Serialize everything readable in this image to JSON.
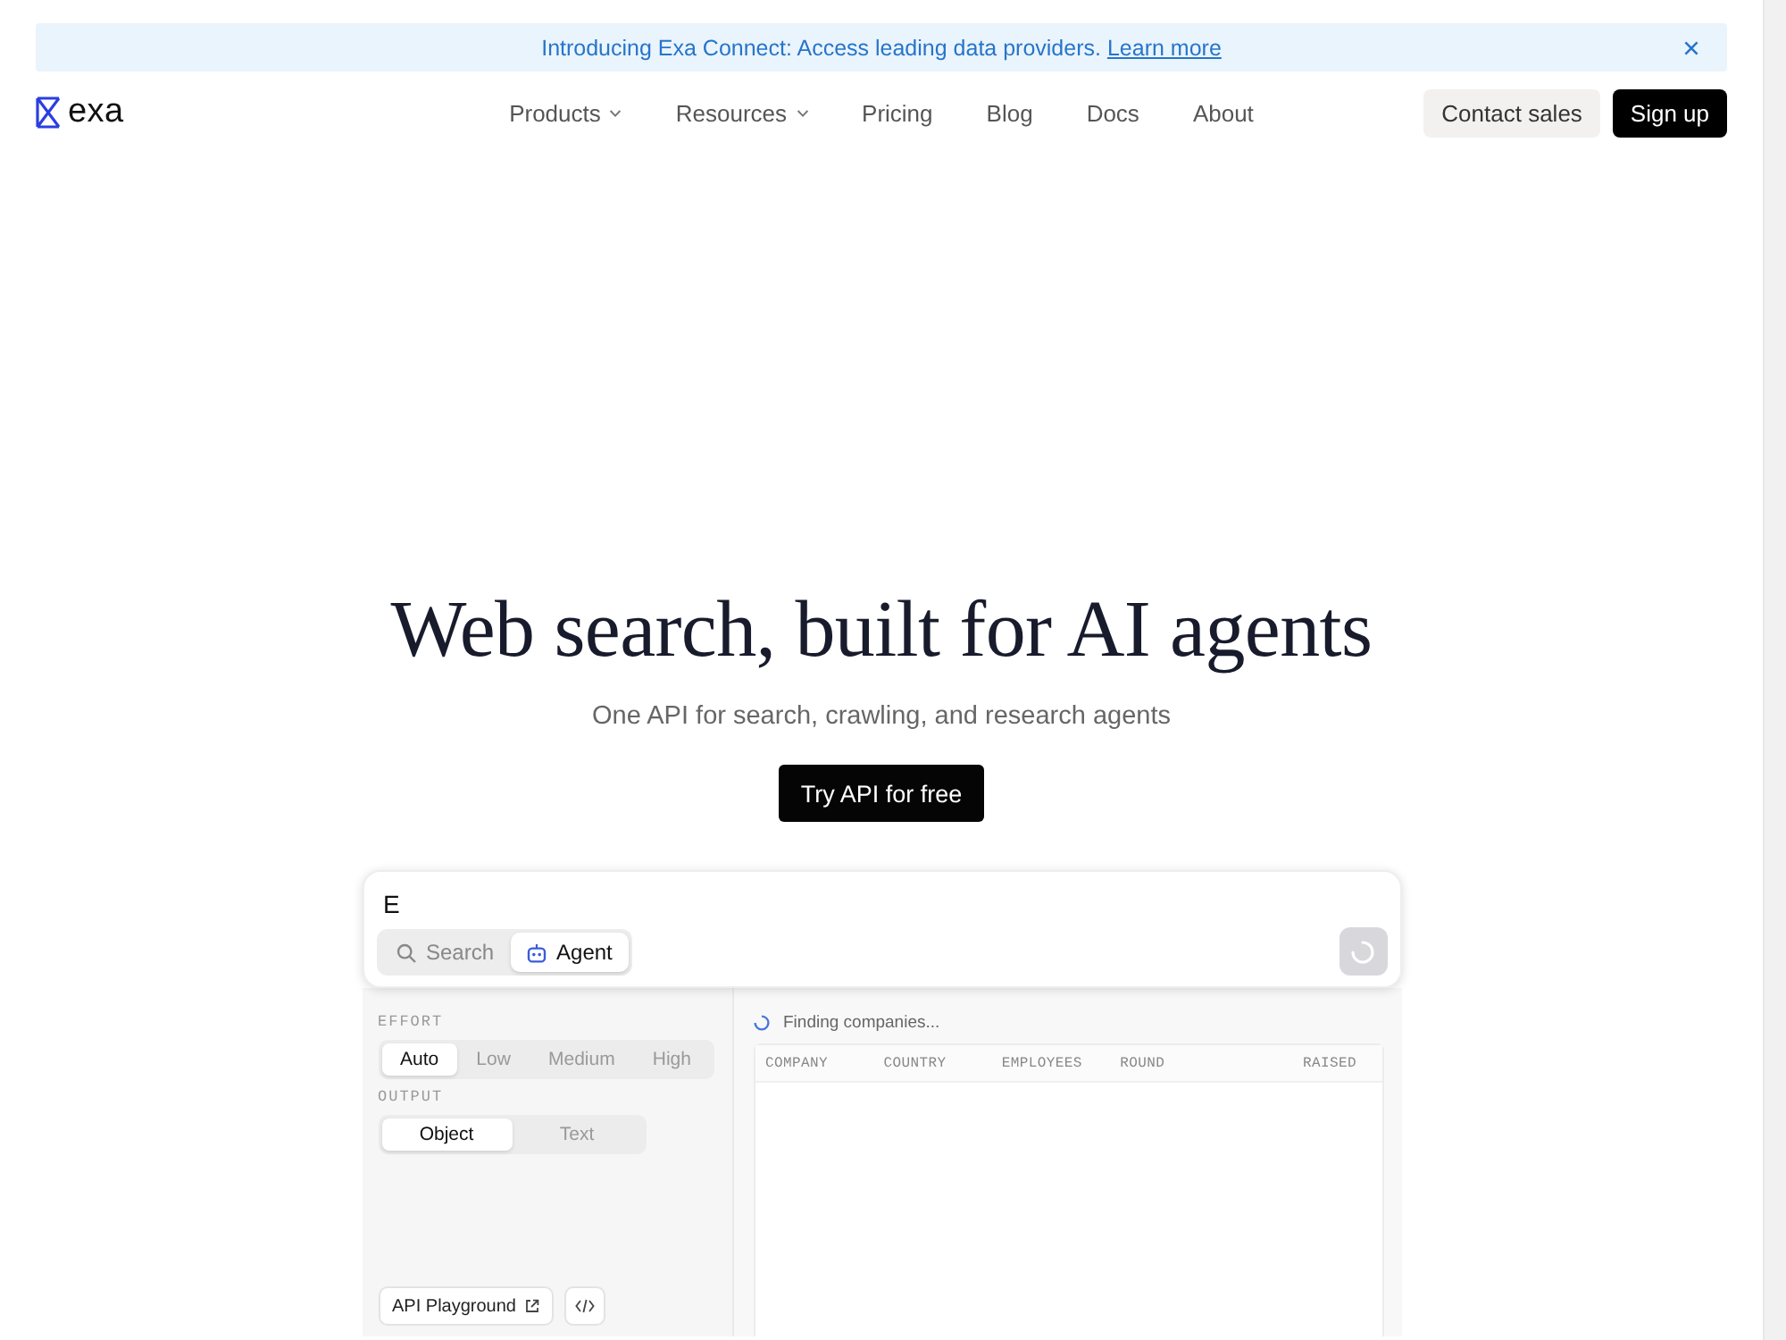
{
  "banner": {
    "text": "Introducing Exa Connect: Access leading data providers.",
    "link": "Learn more"
  },
  "nav": {
    "logo": "exa",
    "links": [
      {
        "label": "Products",
        "dropdown": true
      },
      {
        "label": "Resources",
        "dropdown": true
      },
      {
        "label": "Pricing",
        "dropdown": false
      },
      {
        "label": "Blog",
        "dropdown": false
      },
      {
        "label": "Docs",
        "dropdown": false
      },
      {
        "label": "About",
        "dropdown": false
      }
    ],
    "buttons": [
      {
        "label": "Contact sales",
        "kind": "secondary"
      },
      {
        "label": "Sign up",
        "kind": "primary"
      }
    ]
  },
  "hero": {
    "title": "Web search, built for AI agents",
    "subtitle": "One API for search, crawling, and research agents",
    "cta": "Try API for free"
  },
  "demo": {
    "query": "E",
    "modes": [
      {
        "label": "Search",
        "kind": "search",
        "selected": false
      },
      {
        "label": "Agent",
        "kind": "agent",
        "selected": true
      }
    ],
    "settings": [
      {
        "label": "EFFORT",
        "options": [
          {
            "label": "Auto",
            "selected": true
          },
          {
            "label": "Low",
            "selected": false
          },
          {
            "label": "Medium",
            "selected": false
          },
          {
            "label": "High",
            "selected": false
          }
        ]
      },
      {
        "label": "OUTPUT",
        "options": [
          {
            "label": "Object",
            "selected": true
          },
          {
            "label": "Text",
            "selected": false
          }
        ]
      }
    ],
    "playground_button": "API Playground",
    "status": "Finding companies...",
    "table": {
      "columns": [
        "COMPANY",
        "COUNTRY",
        "EMPLOYEES",
        "ROUND",
        "RAISED"
      ]
    }
  }
}
